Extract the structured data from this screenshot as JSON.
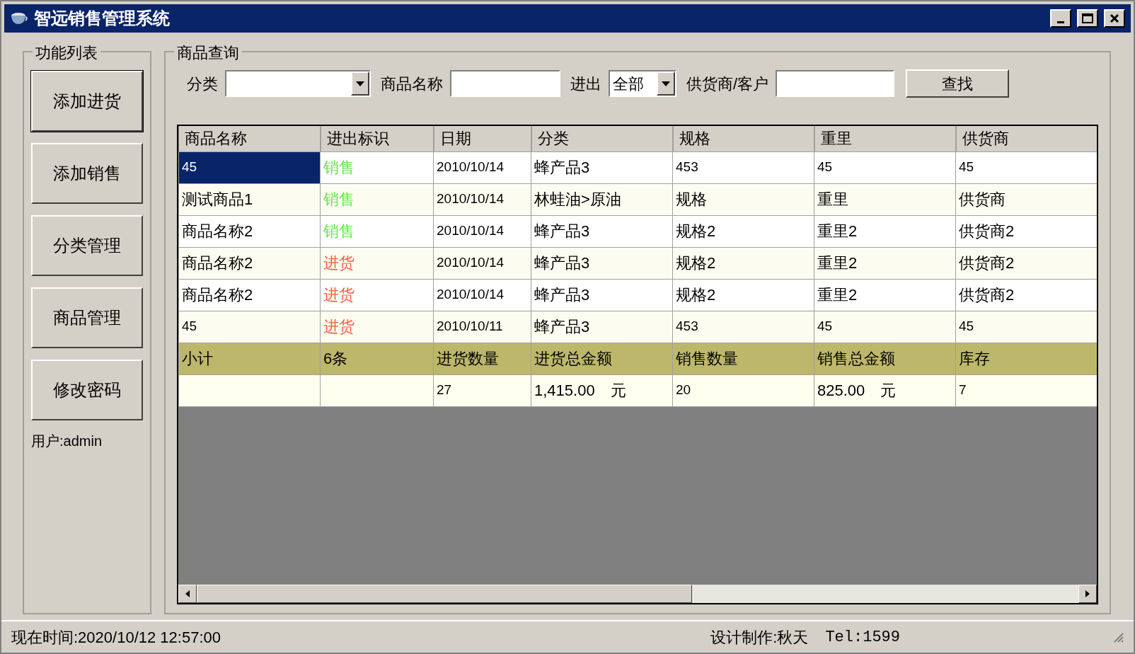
{
  "window": {
    "title": "智远销售管理系统"
  },
  "sidebar": {
    "title": "功能列表",
    "buttons": [
      "添加进货",
      "添加销售",
      "分类管理",
      "商品管理",
      "修改密码"
    ],
    "user": "用户:admin"
  },
  "query": {
    "title": "商品查询",
    "fields": [
      {
        "kind": "combo",
        "label": "分类"
      },
      {
        "kind": "text",
        "label": "商品名称"
      },
      {
        "kind": "combo",
        "label": "进出",
        "value": "全部"
      },
      {
        "kind": "text",
        "label": "供货商/客户"
      }
    ],
    "search_button": "查找"
  },
  "table": {
    "columns": [
      "商品名称",
      "进出标识",
      "日期",
      "分类",
      "规格",
      "重里",
      "供货商"
    ],
    "rows": [
      {
        "kind": "data",
        "selected": true,
        "color": "#66e64d",
        "cells": [
          "45",
          "销售",
          "2010/10/14",
          "蜂产品3",
          "453",
          "45",
          "45"
        ]
      },
      {
        "kind": "data",
        "selected": false,
        "color": "#66e64d",
        "cells": [
          "测试商品1",
          "销售",
          "2010/10/14",
          "林蛙油>原油",
          "规格",
          "重里",
          "供货商"
        ]
      },
      {
        "kind": "data",
        "selected": false,
        "color": "#66e64d",
        "cells": [
          "商品名称2",
          "销售",
          "2010/10/14",
          "蜂产品3",
          "规格2",
          "重里2",
          "供货商2"
        ]
      },
      {
        "kind": "data",
        "selected": false,
        "color": "#f0603c",
        "cells": [
          "商品名称2",
          "进货",
          "2010/10/14",
          "蜂产品3",
          "规格2",
          "重里2",
          "供货商2"
        ]
      },
      {
        "kind": "data",
        "selected": false,
        "color": "#f0603c",
        "cells": [
          "商品名称2",
          "进货",
          "2010/10/14",
          "蜂产品3",
          "规格2",
          "重里2",
          "供货商2"
        ]
      },
      {
        "kind": "data",
        "selected": false,
        "color": "#f0603c",
        "cells": [
          "45",
          "进货",
          "2010/10/11",
          "蜂产品3",
          "453",
          "45",
          "45"
        ]
      },
      {
        "kind": "summary",
        "cells": [
          "小计",
          "6条",
          "进货数量",
          "进货总金额",
          "销售数量",
          "销售总金额",
          "库存"
        ]
      },
      {
        "kind": "totals",
        "cells": [
          "",
          "",
          "27",
          "1,415.00　元",
          "20",
          "825.00　元",
          "7"
        ]
      }
    ]
  },
  "status_bar": {
    "time": "现在时间:2020/10/12 12:57:00",
    "author": "设计制作:秋天",
    "tel": "Tel:1599"
  }
}
